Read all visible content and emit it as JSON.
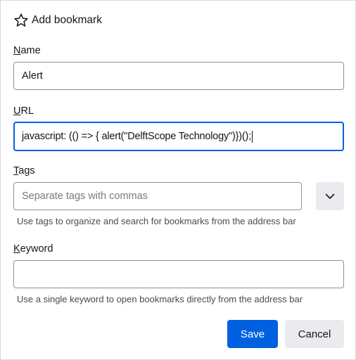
{
  "dialog": {
    "title": "Add bookmark",
    "title_icon": "star-icon"
  },
  "name_field": {
    "label_mnemonic": "N",
    "label_rest": "ame",
    "value": "Alert"
  },
  "url_field": {
    "label_mnemonic": "U",
    "label_rest": "RL",
    "value": "javascript: (() => {  alert(\"DelftScope Technology\")})();"
  },
  "tags_field": {
    "label_mnemonic": "T",
    "label_rest": "ags",
    "placeholder": "Separate tags with commas",
    "value": "",
    "hint": "Use tags to organize and search for bookmarks from the address bar",
    "dropdown_icon": "chevron-down-icon"
  },
  "keyword_field": {
    "label_mnemonic": "K",
    "label_rest": "eyword",
    "value": "",
    "hint": "Use a single keyword to open bookmarks directly from the address bar"
  },
  "buttons": {
    "save_label": "Save",
    "cancel_label": "Cancel"
  },
  "colors": {
    "accent": "#0061e0",
    "secondary_button": "#ebebef",
    "border": "#8f8f9d"
  }
}
